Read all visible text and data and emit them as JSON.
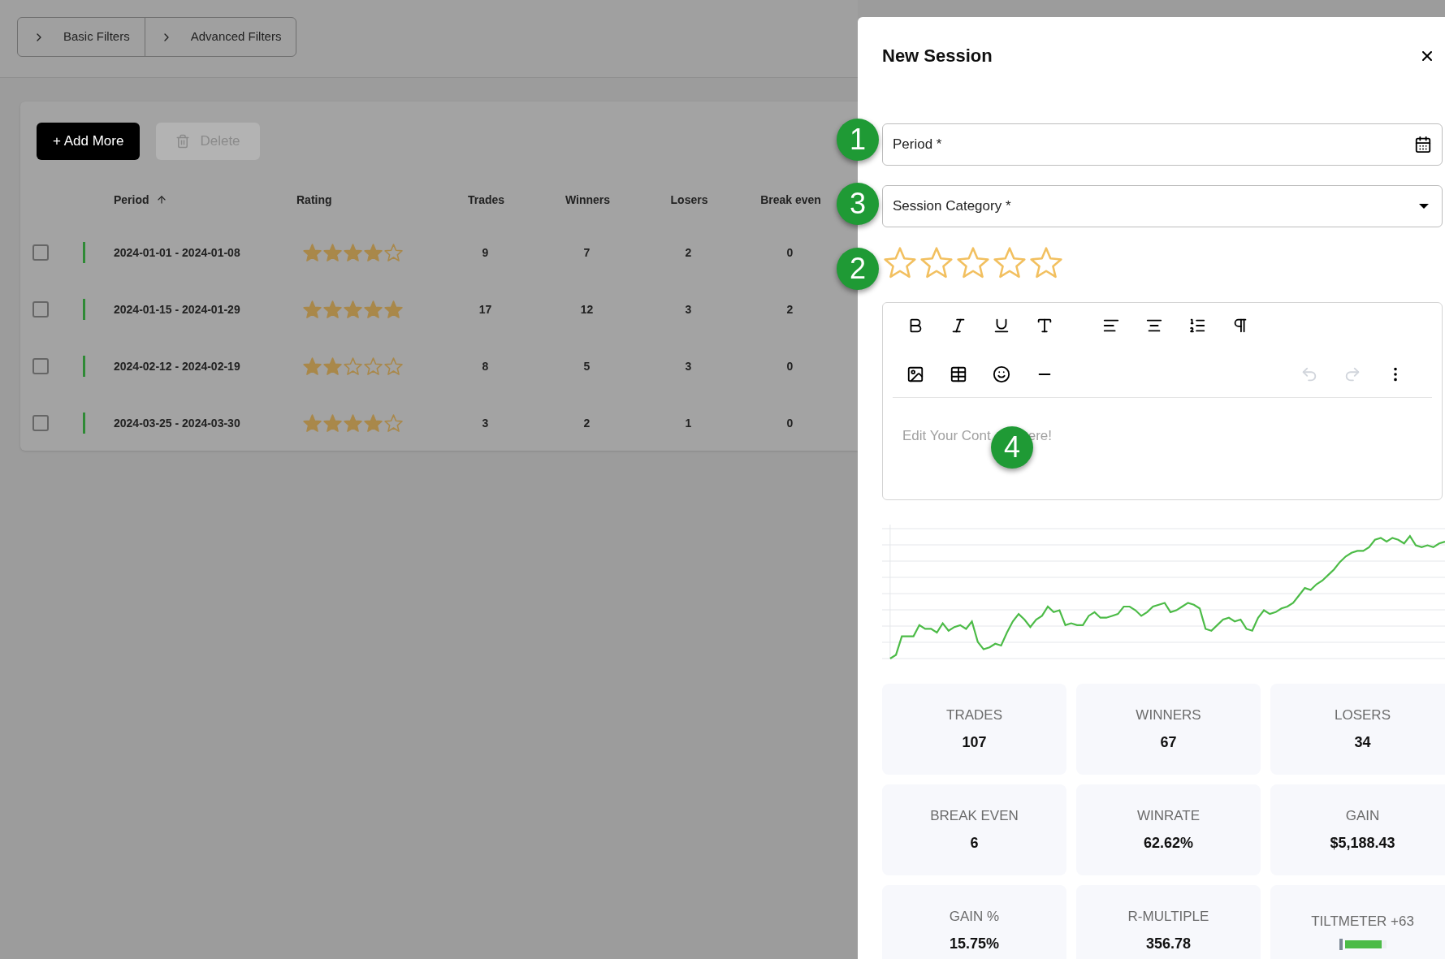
{
  "filters": [
    {
      "label": "Basic Filters",
      "expanded": false
    },
    {
      "label": "Advanced Filters",
      "expanded": false
    }
  ],
  "actions": {
    "add": "+ Add More",
    "delete": {
      "label": "Delete",
      "disabled": true
    }
  },
  "table": {
    "columns": [
      {
        "label": "Period",
        "sorted": true
      },
      {
        "label": "Rating",
        "sorted": false
      },
      {
        "label": "Trades",
        "sorted": false
      },
      {
        "label": "Winners",
        "sorted": false
      },
      {
        "label": "Losers",
        "sorted": false
      },
      {
        "label": "Break even",
        "sorted": false
      }
    ],
    "rows": [
      {
        "checked": false,
        "period": "2024-01-01 - 2024-01-08",
        "stars": 4,
        "trades": "9",
        "winners": "7",
        "losers": "2",
        "break_even": "0"
      },
      {
        "checked": false,
        "period": "2024-01-15 - 2024-01-29",
        "stars": 5,
        "trades": "17",
        "winners": "12",
        "losers": "3",
        "break_even": "2"
      },
      {
        "checked": false,
        "period": "2024-02-12 - 2024-02-19",
        "stars": 2,
        "trades": "8",
        "winners": "5",
        "losers": "3",
        "break_even": "0"
      },
      {
        "checked": false,
        "period": "2024-03-25 - 2024-03-30",
        "stars": 4,
        "trades": "3",
        "winners": "2",
        "losers": "1",
        "break_even": "0"
      }
    ]
  },
  "dialog": {
    "title": "New Session",
    "period": {
      "placeholder": "Period *"
    },
    "category": {
      "placeholder": "Session Category *"
    },
    "rating": {
      "stars": 0
    },
    "editor": {
      "visible_start": "Edit Your Cont",
      "visible_end": "ere!"
    },
    "stats": [
      {
        "label": "TRADES",
        "value": "107",
        "kind": "text"
      },
      {
        "label": "WINNERS",
        "value": "67",
        "kind": "text"
      },
      {
        "label": "LOSERS",
        "value": "34",
        "kind": "text"
      },
      {
        "label": "BREAK EVEN",
        "value": "6",
        "kind": "text"
      },
      {
        "label": "WINRATE",
        "value": "62.62%",
        "kind": "text"
      },
      {
        "label": "GAIN",
        "value": "$5,188.43",
        "kind": "text"
      },
      {
        "label": "GAIN %",
        "value": "15.75%",
        "kind": "text"
      },
      {
        "label": "R-MULTIPLE",
        "value": "356.78",
        "kind": "text"
      },
      {
        "label": "TILTMETER +63",
        "kind": "meter",
        "level": 0.9
      }
    ]
  },
  "annotations": [
    {
      "label": "1"
    },
    {
      "label": "3"
    },
    {
      "label": "2"
    },
    {
      "label": "4"
    }
  ]
}
